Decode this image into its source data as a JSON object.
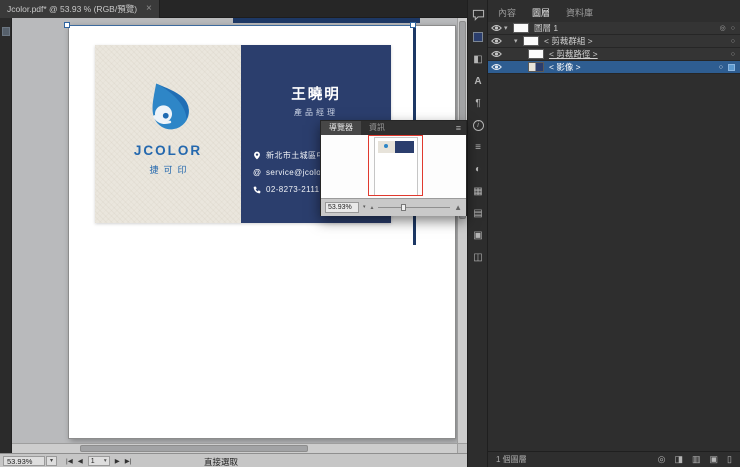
{
  "titlebar": {
    "document_tab": "Jcolor.pdf* @ 53.93 % (RGB/預覽)",
    "close": "×"
  },
  "card": {
    "brand": "JCOLOR",
    "brand_sub": "捷可印",
    "name": "王曉明",
    "title": "產品經理",
    "address": "新北市土城區中央",
    "email": "service@jcolor",
    "phone": "02-8273-2111"
  },
  "navigator": {
    "tab_navigator": "導覽器",
    "tab_info": "資訊",
    "zoom": "53.93%"
  },
  "panel": {
    "tab_properties": "內容",
    "tab_layers": "圖層",
    "tab_libraries": "資料庫",
    "layers": [
      {
        "label": "圖層 1"
      },
      {
        "label": "< 剪裁群組 >"
      },
      {
        "label": "< 剪裁路徑 >"
      },
      {
        "label": "< 影像 >"
      }
    ],
    "footer_count": "1 個圖層"
  },
  "statusbar": {
    "zoom": "53.93%",
    "artboard": "1",
    "tool": "直接選取"
  },
  "icons": {
    "pathfinder": "◧",
    "character": "A",
    "paragraph": "¶",
    "info": "i",
    "stroke": "≡",
    "transparency": "◐",
    "swatches": "▦",
    "symbols": "▤",
    "artboards": "▣",
    "export": "◫",
    "menu": "≡",
    "disclosure": "▾",
    "dropdown": "▾",
    "target": "○",
    "appearance": "◎",
    "first": "|◀",
    "prev": "◀",
    "next": "▶",
    "last": "▶|",
    "mountain": "▲",
    "locate": "◎",
    "mask": "◨",
    "new_sublayer": "▥",
    "new_layer": "▣",
    "delete_layer": "▯",
    "at": "@"
  },
  "colors": {
    "card_navy": "#2b3e6d",
    "logo_blue": "#2e86c7",
    "proxy_red": "#e03a2f",
    "selection_blue": "#2f64a0"
  }
}
